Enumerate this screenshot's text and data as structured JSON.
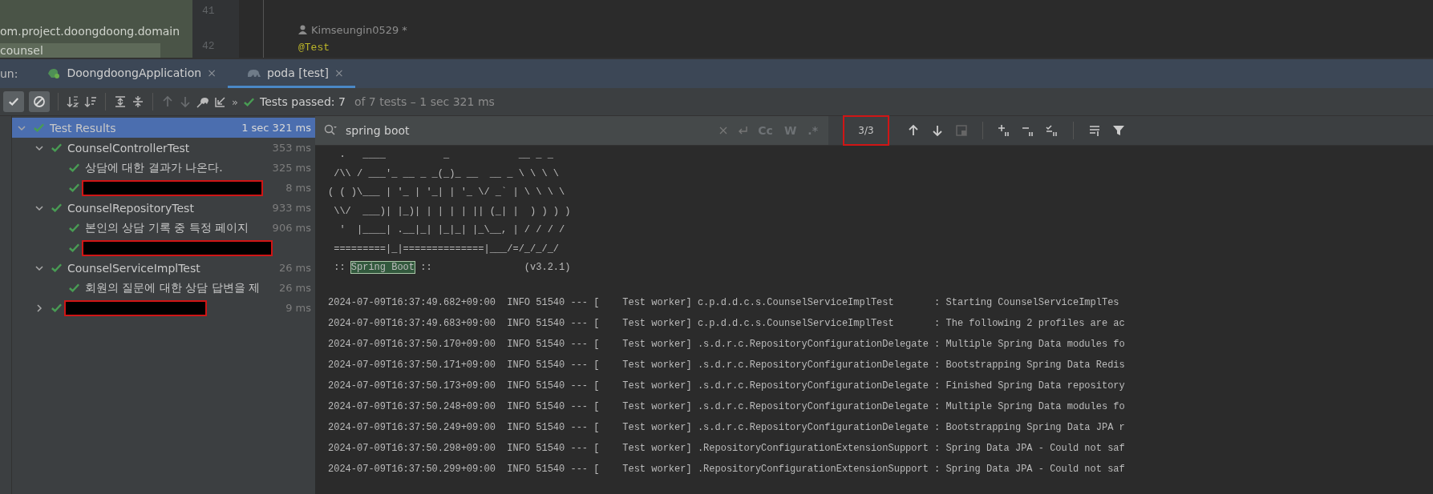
{
  "project_pane": {
    "items": [
      {
        "label": "om.project.doongdoong.domain",
        "selected": false
      },
      {
        "label": "counsel",
        "selected": true
      }
    ]
  },
  "editor": {
    "lines": [
      {
        "number": "41",
        "kind": "blank"
      },
      {
        "text": "Kimseungin0529 *",
        "kind": "author"
      },
      {
        "number": "42",
        "text": "@Test",
        "kind": "annotation"
      }
    ]
  },
  "run_bar": {
    "label": "un:",
    "tabs": [
      {
        "label": "DoongdoongApplication",
        "close": "×",
        "selected": false
      },
      {
        "label": "poda [test]",
        "close": "×",
        "selected": true
      }
    ]
  },
  "toolbar": {
    "more": "»",
    "show_passed": true,
    "show_ignored": true,
    "status": "Tests passed: 7",
    "status_detail": "of 7 tests – 1 sec 321 ms"
  },
  "tree": [
    {
      "label": "Test Results",
      "time": "1 sec 321 ms",
      "selected": true,
      "expanded": true,
      "kind": "test",
      "children": [
        {
          "label": "CounselControllerTest",
          "time": "353 ms",
          "selected": false,
          "expanded": true,
          "kind": "test",
          "children": [
            {
              "label": "상담에 대한 결과가 나온다.",
              "time": "325 ms",
              "selected": false,
              "kind": "test"
            },
            {
              "time": "8 ms",
              "selected": false,
              "kind": "redacted"
            }
          ]
        },
        {
          "label": "CounselRepositoryTest",
          "time": "933 ms",
          "selected": false,
          "expanded": true,
          "kind": "test",
          "children": [
            {
              "label": "본인의 상담 기록 중 특정 페이지",
              "time": "906 ms",
              "selected": false,
              "kind": "test"
            },
            {
              "selected": false,
              "kind": "redacted"
            }
          ]
        },
        {
          "label": "CounselServiceImplTest",
          "time": "26 ms",
          "selected": false,
          "expanded": true,
          "kind": "test",
          "children": [
            {
              "label": "회원의 질문에 대한 상담 답변을 제",
              "time": "26 ms",
              "selected": false,
              "kind": "test"
            }
          ]
        },
        {
          "time": "9 ms",
          "selected": false,
          "expanded": false,
          "kind": "redacted",
          "collapsed_group": true
        }
      ]
    }
  ],
  "search": {
    "value": "spring boot",
    "match_count": "3/3",
    "options": [
      {
        "label": "Cc",
        "on": false
      },
      {
        "label": "W",
        "on": false
      },
      {
        "label": ".*",
        "on": false
      }
    ]
  },
  "console": {
    "banner": [
      "  .   ____          _            __ _ _",
      " /\\\\ / ___'_ __ _ _(_)_ __  __ _ \\ \\ \\ \\",
      "( ( )\\___ | '_ | '_| | '_ \\/ _` | \\ \\ \\ \\",
      " \\\\/  ___)| |_)| | | | | || (_| |  ) ) ) )",
      "  '  |____| .__|_| |_|_| |_\\__, | / / / /",
      " =========|_|==============|___/=/_/_/_/"
    ],
    "banner_last": {
      "before": " :: ",
      "match": "Spring Boot",
      "after": " ::                (v3.2.1)"
    },
    "log": [
      "2024-07-09T16:37:49.682+09:00  INFO 51540 --- [    Test worker] c.p.d.d.c.s.CounselServiceImplTest       : Starting CounselServiceImplTes",
      "2024-07-09T16:37:49.683+09:00  INFO 51540 --- [    Test worker] c.p.d.d.c.s.CounselServiceImplTest       : The following 2 profiles are ac",
      "2024-07-09T16:37:50.170+09:00  INFO 51540 --- [    Test worker] .s.d.r.c.RepositoryConfigurationDelegate : Multiple Spring Data modules fo",
      "2024-07-09T16:37:50.171+09:00  INFO 51540 --- [    Test worker] .s.d.r.c.RepositoryConfigurationDelegate : Bootstrapping Spring Data Redis",
      "2024-07-09T16:37:50.173+09:00  INFO 51540 --- [    Test worker] .s.d.r.c.RepositoryConfigurationDelegate : Finished Spring Data repository",
      "2024-07-09T16:37:50.248+09:00  INFO 51540 --- [    Test worker] .s.d.r.c.RepositoryConfigurationDelegate : Multiple Spring Data modules fo",
      "2024-07-09T16:37:50.249+09:00  INFO 51540 --- [    Test worker] .s.d.r.c.RepositoryConfigurationDelegate : Bootstrapping Spring Data JPA r",
      "2024-07-09T16:37:50.298+09:00  INFO 51540 --- [    Test worker] .RepositoryConfigurationExtensionSupport : Spring Data JPA - Could not saf",
      "2024-07-09T16:37:50.299+09:00  INFO 51540 --- [    Test worker] .RepositoryConfigurationExtensionSupport : Spring Data JPA - Could not saf"
    ]
  }
}
